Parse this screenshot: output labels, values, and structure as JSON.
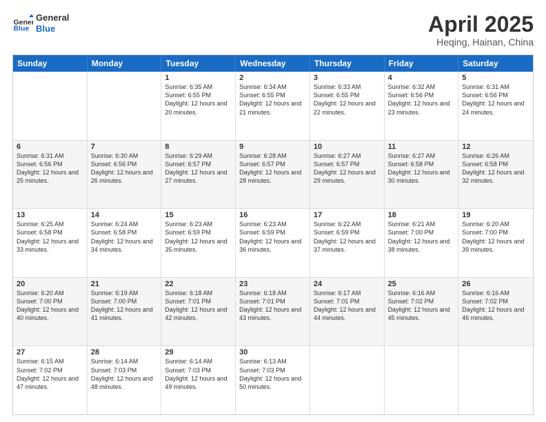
{
  "logo": {
    "text_general": "General",
    "text_blue": "Blue"
  },
  "title": "April 2025",
  "subtitle": "Heqing, Hainan, China",
  "header_days": [
    "Sunday",
    "Monday",
    "Tuesday",
    "Wednesday",
    "Thursday",
    "Friday",
    "Saturday"
  ],
  "weeks": [
    {
      "bg": "white",
      "cells": [
        {
          "day": "",
          "content": ""
        },
        {
          "day": "",
          "content": ""
        },
        {
          "day": "1",
          "content": "Sunrise: 6:35 AM\nSunset: 6:55 PM\nDaylight: 12 hours and 20 minutes."
        },
        {
          "day": "2",
          "content": "Sunrise: 6:34 AM\nSunset: 6:55 PM\nDaylight: 12 hours and 21 minutes."
        },
        {
          "day": "3",
          "content": "Sunrise: 6:33 AM\nSunset: 6:55 PM\nDaylight: 12 hours and 22 minutes."
        },
        {
          "day": "4",
          "content": "Sunrise: 6:32 AM\nSunset: 6:56 PM\nDaylight: 12 hours and 23 minutes."
        },
        {
          "day": "5",
          "content": "Sunrise: 6:31 AM\nSunset: 6:56 PM\nDaylight: 12 hours and 24 minutes."
        }
      ]
    },
    {
      "bg": "light",
      "cells": [
        {
          "day": "6",
          "content": "Sunrise: 6:31 AM\nSunset: 6:56 PM\nDaylight: 12 hours and 25 minutes."
        },
        {
          "day": "7",
          "content": "Sunrise: 6:30 AM\nSunset: 6:56 PM\nDaylight: 12 hours and 26 minutes."
        },
        {
          "day": "8",
          "content": "Sunrise: 6:29 AM\nSunset: 6:57 PM\nDaylight: 12 hours and 27 minutes."
        },
        {
          "day": "9",
          "content": "Sunrise: 6:28 AM\nSunset: 6:57 PM\nDaylight: 12 hours and 28 minutes."
        },
        {
          "day": "10",
          "content": "Sunrise: 6:27 AM\nSunset: 6:57 PM\nDaylight: 12 hours and 29 minutes."
        },
        {
          "day": "11",
          "content": "Sunrise: 6:27 AM\nSunset: 6:58 PM\nDaylight: 12 hours and 30 minutes."
        },
        {
          "day": "12",
          "content": "Sunrise: 6:26 AM\nSunset: 6:58 PM\nDaylight: 12 hours and 32 minutes."
        }
      ]
    },
    {
      "bg": "white",
      "cells": [
        {
          "day": "13",
          "content": "Sunrise: 6:25 AM\nSunset: 6:58 PM\nDaylight: 12 hours and 33 minutes."
        },
        {
          "day": "14",
          "content": "Sunrise: 6:24 AM\nSunset: 6:58 PM\nDaylight: 12 hours and 34 minutes."
        },
        {
          "day": "15",
          "content": "Sunrise: 6:23 AM\nSunset: 6:59 PM\nDaylight: 12 hours and 35 minutes."
        },
        {
          "day": "16",
          "content": "Sunrise: 6:23 AM\nSunset: 6:59 PM\nDaylight: 12 hours and 36 minutes."
        },
        {
          "day": "17",
          "content": "Sunrise: 6:22 AM\nSunset: 6:59 PM\nDaylight: 12 hours and 37 minutes."
        },
        {
          "day": "18",
          "content": "Sunrise: 6:21 AM\nSunset: 7:00 PM\nDaylight: 12 hours and 38 minutes."
        },
        {
          "day": "19",
          "content": "Sunrise: 6:20 AM\nSunset: 7:00 PM\nDaylight: 12 hours and 39 minutes."
        }
      ]
    },
    {
      "bg": "light",
      "cells": [
        {
          "day": "20",
          "content": "Sunrise: 6:20 AM\nSunset: 7:00 PM\nDaylight: 12 hours and 40 minutes."
        },
        {
          "day": "21",
          "content": "Sunrise: 6:19 AM\nSunset: 7:00 PM\nDaylight: 12 hours and 41 minutes."
        },
        {
          "day": "22",
          "content": "Sunrise: 6:18 AM\nSunset: 7:01 PM\nDaylight: 12 hours and 42 minutes."
        },
        {
          "day": "23",
          "content": "Sunrise: 6:18 AM\nSunset: 7:01 PM\nDaylight: 12 hours and 43 minutes."
        },
        {
          "day": "24",
          "content": "Sunrise: 6:17 AM\nSunset: 7:01 PM\nDaylight: 12 hours and 44 minutes."
        },
        {
          "day": "25",
          "content": "Sunrise: 6:16 AM\nSunset: 7:02 PM\nDaylight: 12 hours and 45 minutes."
        },
        {
          "day": "26",
          "content": "Sunrise: 6:16 AM\nSunset: 7:02 PM\nDaylight: 12 hours and 46 minutes."
        }
      ]
    },
    {
      "bg": "white",
      "cells": [
        {
          "day": "27",
          "content": "Sunrise: 6:15 AM\nSunset: 7:02 PM\nDaylight: 12 hours and 47 minutes."
        },
        {
          "day": "28",
          "content": "Sunrise: 6:14 AM\nSunset: 7:03 PM\nDaylight: 12 hours and 48 minutes."
        },
        {
          "day": "29",
          "content": "Sunrise: 6:14 AM\nSunset: 7:03 PM\nDaylight: 12 hours and 49 minutes."
        },
        {
          "day": "30",
          "content": "Sunrise: 6:13 AM\nSunset: 7:03 PM\nDaylight: 12 hours and 50 minutes."
        },
        {
          "day": "",
          "content": ""
        },
        {
          "day": "",
          "content": ""
        },
        {
          "day": "",
          "content": ""
        }
      ]
    }
  ]
}
